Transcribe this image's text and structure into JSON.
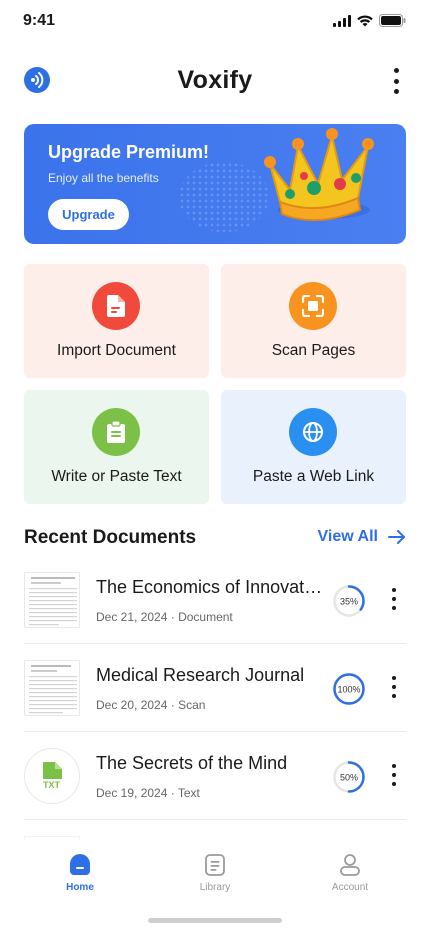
{
  "status_bar": {
    "time": "9:41"
  },
  "app": {
    "title": "Voxify"
  },
  "banner": {
    "title": "Upgrade Premium!",
    "subtitle": "Enjoy all the benefits",
    "button_label": "Upgrade"
  },
  "actions": [
    {
      "label": "Import Document",
      "icon": "document-icon",
      "color": "#ef4a3c",
      "bg": "#fdeeea"
    },
    {
      "label": "Scan Pages",
      "icon": "scan-icon",
      "color": "#f7931e",
      "bg": "#fdeeea"
    },
    {
      "label": "Write or Paste Text",
      "icon": "clipboard-icon",
      "color": "#7cc047",
      "bg": "#eaf6ee"
    },
    {
      "label": "Paste a Web Link",
      "icon": "globe-icon",
      "color": "#2a8ff0",
      "bg": "#e9f1fd"
    }
  ],
  "recent": {
    "title": "Recent Documents",
    "view_all": "View All",
    "items": [
      {
        "title": "The Economics of Innovation",
        "date": "Dec 21, 2024",
        "type": "Document",
        "progress_label": "35%",
        "progress": 0.35
      },
      {
        "title": "Medical Research Journal",
        "date": "Dec 20, 2024",
        "type": "Scan",
        "progress_label": "100%",
        "progress": 1.0
      },
      {
        "title": "The Secrets of the Mind",
        "date": "Dec 19, 2024",
        "type": "Text",
        "progress_label": "50%",
        "progress": 0.5,
        "badge": "TXT"
      }
    ]
  },
  "nav": {
    "items": [
      {
        "label": "Home",
        "icon": "home-icon",
        "active": true
      },
      {
        "label": "Library",
        "icon": "library-icon",
        "active": false
      },
      {
        "label": "Account",
        "icon": "account-icon",
        "active": false
      }
    ]
  },
  "colors": {
    "accent": "#2f6fe4"
  }
}
